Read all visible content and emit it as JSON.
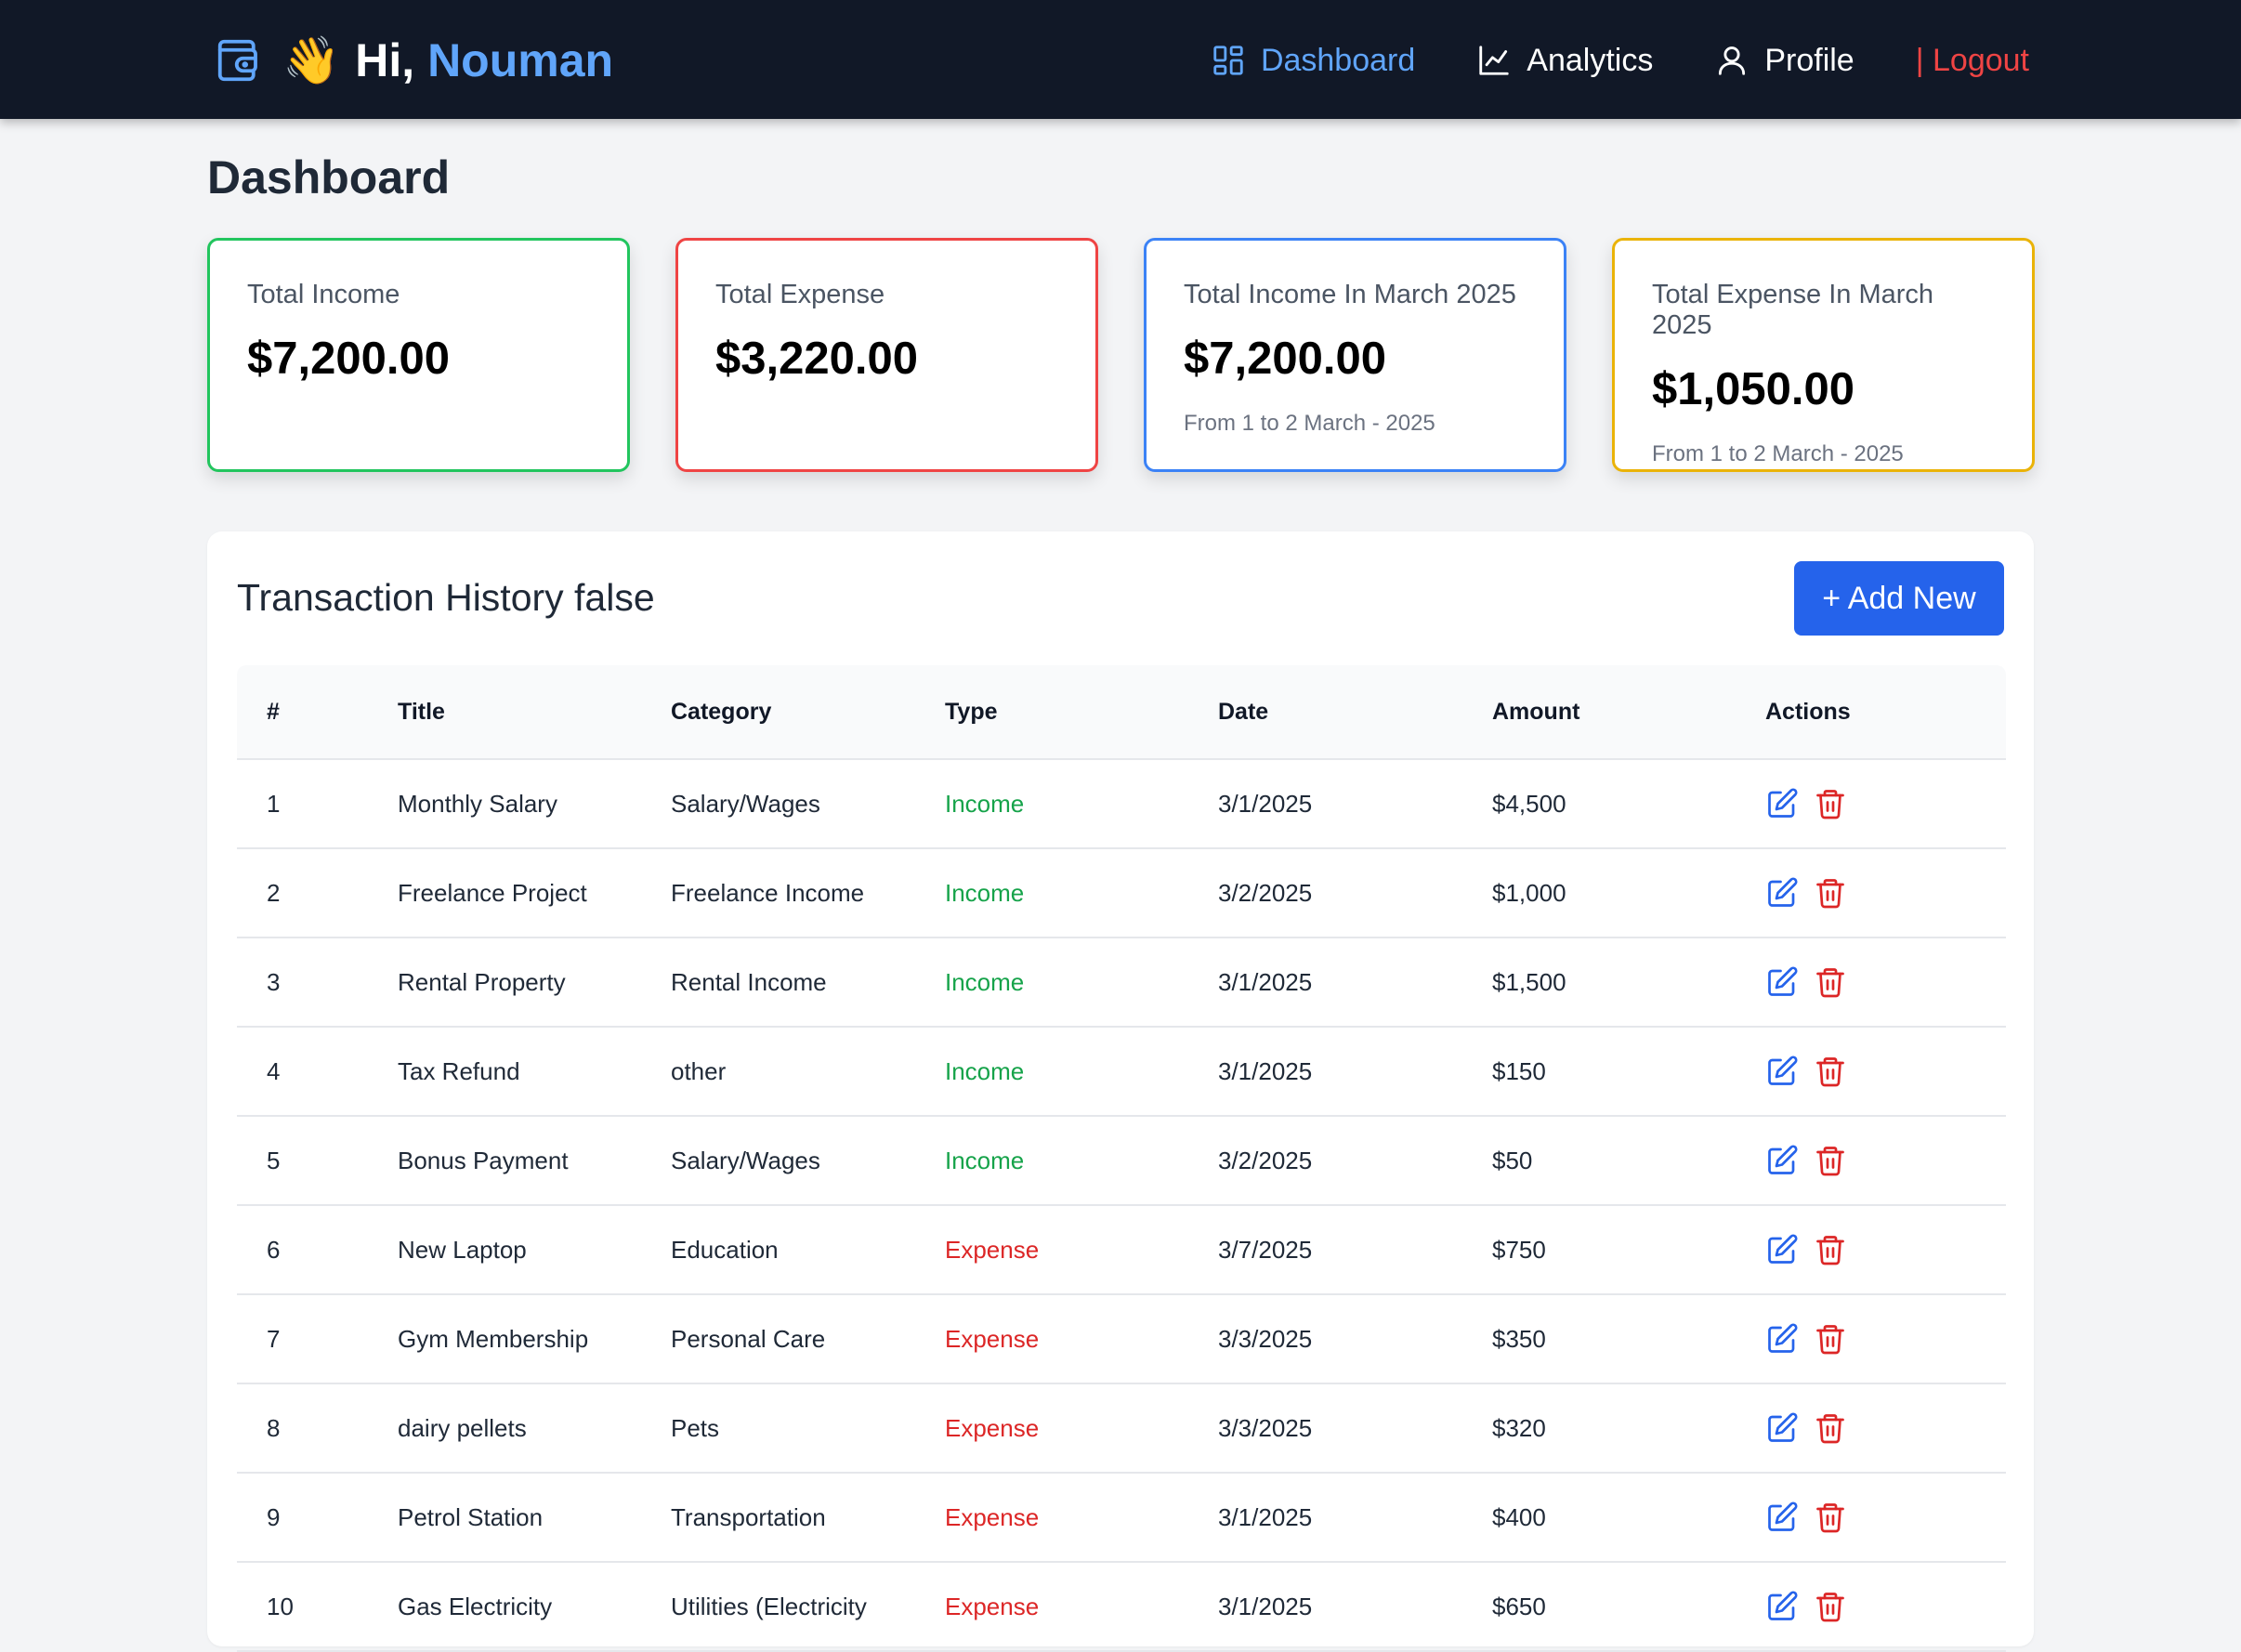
{
  "header": {
    "wave_emoji": "👋",
    "greeting": "Hi, ",
    "username": "Nouman",
    "nav": [
      {
        "label": "Dashboard",
        "icon": "grid-icon"
      },
      {
        "label": "Analytics",
        "icon": "line-chart-icon"
      },
      {
        "label": "Profile",
        "icon": "user-icon"
      },
      {
        "label": "| Logout",
        "icon": ""
      }
    ],
    "colors": {
      "bg": "#111827",
      "active": "#60a5fa",
      "logout": "#ef4444"
    }
  },
  "page_title": "Dashboard",
  "stats": [
    {
      "label": "Total Income",
      "value": "$7,200.00",
      "range": "",
      "border": "#22c55e"
    },
    {
      "label": "Total Expense",
      "value": "$3,220.00",
      "range": "",
      "border": "#ef4444"
    },
    {
      "label": "Total Income In March 2025",
      "value": "$7,200.00",
      "range": "From 1 to 2 March - 2025",
      "border": "#3b82f6"
    },
    {
      "label": "Total Expense In March 2025",
      "value": "$1,050.00",
      "range": "From 1 to 2 March - 2025",
      "border": "#eab308"
    }
  ],
  "transactions": {
    "title": "Transaction History false",
    "add_label": "+ Add New",
    "columns": [
      "#",
      "Title",
      "Category",
      "Type",
      "Date",
      "Amount",
      "Actions"
    ],
    "rows": [
      {
        "num": "1",
        "title": "Monthly Salary",
        "category": "Salary/Wages",
        "type": "Income",
        "date": "3/1/2025",
        "amount": "$4,500"
      },
      {
        "num": "2",
        "title": "Freelance Project",
        "category": "Freelance Income",
        "type": "Income",
        "date": "3/2/2025",
        "amount": "$1,000"
      },
      {
        "num": "3",
        "title": "Rental Property",
        "category": "Rental Income",
        "type": "Income",
        "date": "3/1/2025",
        "amount": "$1,500"
      },
      {
        "num": "4",
        "title": "Tax Refund",
        "category": "other",
        "type": "Income",
        "date": "3/1/2025",
        "amount": "$150"
      },
      {
        "num": "5",
        "title": "Bonus Payment",
        "category": "Salary/Wages",
        "type": "Income",
        "date": "3/2/2025",
        "amount": "$50"
      },
      {
        "num": "6",
        "title": "New Laptop",
        "category": "Education",
        "type": "Expense",
        "date": "3/7/2025",
        "amount": "$750"
      },
      {
        "num": "7",
        "title": "Gym Membership",
        "category": "Personal Care",
        "type": "Expense",
        "date": "3/3/2025",
        "amount": "$350"
      },
      {
        "num": "8",
        "title": "dairy pellets",
        "category": "Pets",
        "type": "Expense",
        "date": "3/3/2025",
        "amount": "$320"
      },
      {
        "num": "9",
        "title": "Petrol Station",
        "category": "Transportation",
        "type": "Expense",
        "date": "3/1/2025",
        "amount": "$400"
      },
      {
        "num": "10",
        "title": "Gas Electricity",
        "category": "Utilities (Electricity",
        "type": "Expense",
        "date": "3/1/2025",
        "amount": "$650"
      }
    ],
    "colors": {
      "income": "#16a34a",
      "expense": "#dc2626",
      "edit": "#2563eb",
      "delete": "#dc2626"
    }
  }
}
